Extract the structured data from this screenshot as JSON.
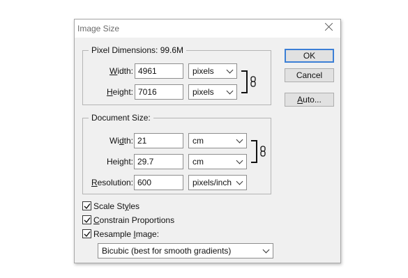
{
  "window": {
    "title": "Image Size"
  },
  "pixel_dimensions": {
    "legend": "Pixel Dimensions:  99.6M",
    "width": {
      "label_u": "W",
      "label_rest": "idth:",
      "value": "4961",
      "unit": "pixels"
    },
    "height": {
      "label_u": "H",
      "label_rest": "eight:",
      "value": "7016",
      "unit": "pixels"
    }
  },
  "document_size": {
    "legend": "Document Size:",
    "width": {
      "label_pre": "Wi",
      "label_u": "d",
      "label_rest": "th:",
      "value": "21",
      "unit": "cm"
    },
    "height": {
      "label_pre": "Hei",
      "label_u": "g",
      "label_rest": "ht:",
      "value": "29.7",
      "unit": "cm"
    },
    "resolution": {
      "label_u": "R",
      "label_rest": "esolution:",
      "value": "600",
      "unit": "pixels/inch"
    }
  },
  "options": {
    "scale_styles": {
      "pre": "Scale St",
      "u": "y",
      "rest": "les",
      "checked": true
    },
    "constrain": {
      "pre": "",
      "u": "C",
      "rest": "onstrain Proportions",
      "checked": true
    },
    "resample": {
      "pre": "Resample ",
      "u": "I",
      "rest": "mage:",
      "checked": true
    },
    "method": "Bicubic (best for smooth gradients)"
  },
  "buttons": {
    "ok": "OK",
    "cancel": "Cancel",
    "auto_u": "A",
    "auto_rest": "uto..."
  },
  "icons": {
    "close": "close-icon",
    "link": "chain-link-icon"
  }
}
